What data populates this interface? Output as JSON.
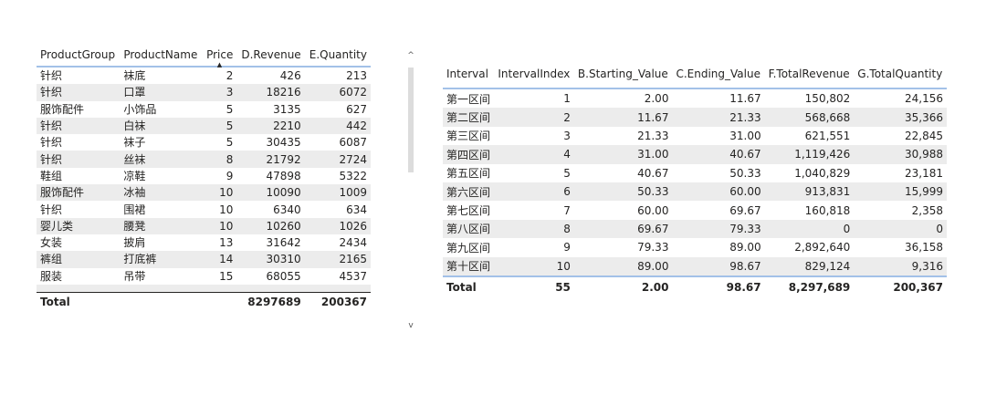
{
  "left_table": {
    "columns": [
      "ProductGroup",
      "ProductName",
      "Price",
      "D.Revenue",
      "E.Quantity"
    ],
    "rows": [
      [
        "针织",
        "袜底",
        "2",
        "426",
        "213"
      ],
      [
        "针织",
        "口罩",
        "3",
        "18216",
        "6072"
      ],
      [
        "服饰配件",
        "小饰品",
        "5",
        "3135",
        "627"
      ],
      [
        "针织",
        "白袜",
        "5",
        "2210",
        "442"
      ],
      [
        "针织",
        "袜子",
        "5",
        "30435",
        "6087"
      ],
      [
        "针织",
        "丝袜",
        "8",
        "21792",
        "2724"
      ],
      [
        "鞋组",
        "凉鞋",
        "9",
        "47898",
        "5322"
      ],
      [
        "服饰配件",
        "冰袖",
        "10",
        "10090",
        "1009"
      ],
      [
        "针织",
        "围裙",
        "10",
        "6340",
        "634"
      ],
      [
        "婴儿类",
        "腰凳",
        "10",
        "10260",
        "1026"
      ],
      [
        "女装",
        "披肩",
        "13",
        "31642",
        "2434"
      ],
      [
        "裤组",
        "打底裤",
        "14",
        "30310",
        "2165"
      ],
      [
        "服装",
        "吊带",
        "15",
        "68055",
        "4537"
      ]
    ],
    "total": {
      "label": "Total",
      "revenue": "8297689",
      "quantity": "200367"
    }
  },
  "scrollbar": {
    "up_icon": "▲",
    "down_icon": "▼"
  },
  "right_table": {
    "columns": [
      "Interval",
      "IntervalIndex",
      "B.Starting_Value",
      "C.Ending_Value",
      "F.TotalRevenue",
      "G.TotalQuantity"
    ],
    "rows": [
      [
        "第一区间",
        "1",
        "2.00",
        "11.67",
        "150,802",
        "24,156"
      ],
      [
        "第二区间",
        "2",
        "11.67",
        "21.33",
        "568,668",
        "35,366"
      ],
      [
        "第三区间",
        "3",
        "21.33",
        "31.00",
        "621,551",
        "22,845"
      ],
      [
        "第四区间",
        "4",
        "31.00",
        "40.67",
        "1,119,426",
        "30,988"
      ],
      [
        "第五区间",
        "5",
        "40.67",
        "50.33",
        "1,040,829",
        "23,181"
      ],
      [
        "第六区间",
        "6",
        "50.33",
        "60.00",
        "913,831",
        "15,999"
      ],
      [
        "第七区间",
        "7",
        "60.00",
        "69.67",
        "160,818",
        "2,358"
      ],
      [
        "第八区间",
        "8",
        "69.67",
        "79.33",
        "0",
        "0"
      ],
      [
        "第九区间",
        "9",
        "79.33",
        "89.00",
        "2,892,640",
        "36,158"
      ],
      [
        "第十区间",
        "10",
        "89.00",
        "98.67",
        "829,124",
        "9,316"
      ]
    ],
    "total": [
      "Total",
      "55",
      "2.00",
      "98.67",
      "8,297,689",
      "200,367"
    ]
  }
}
